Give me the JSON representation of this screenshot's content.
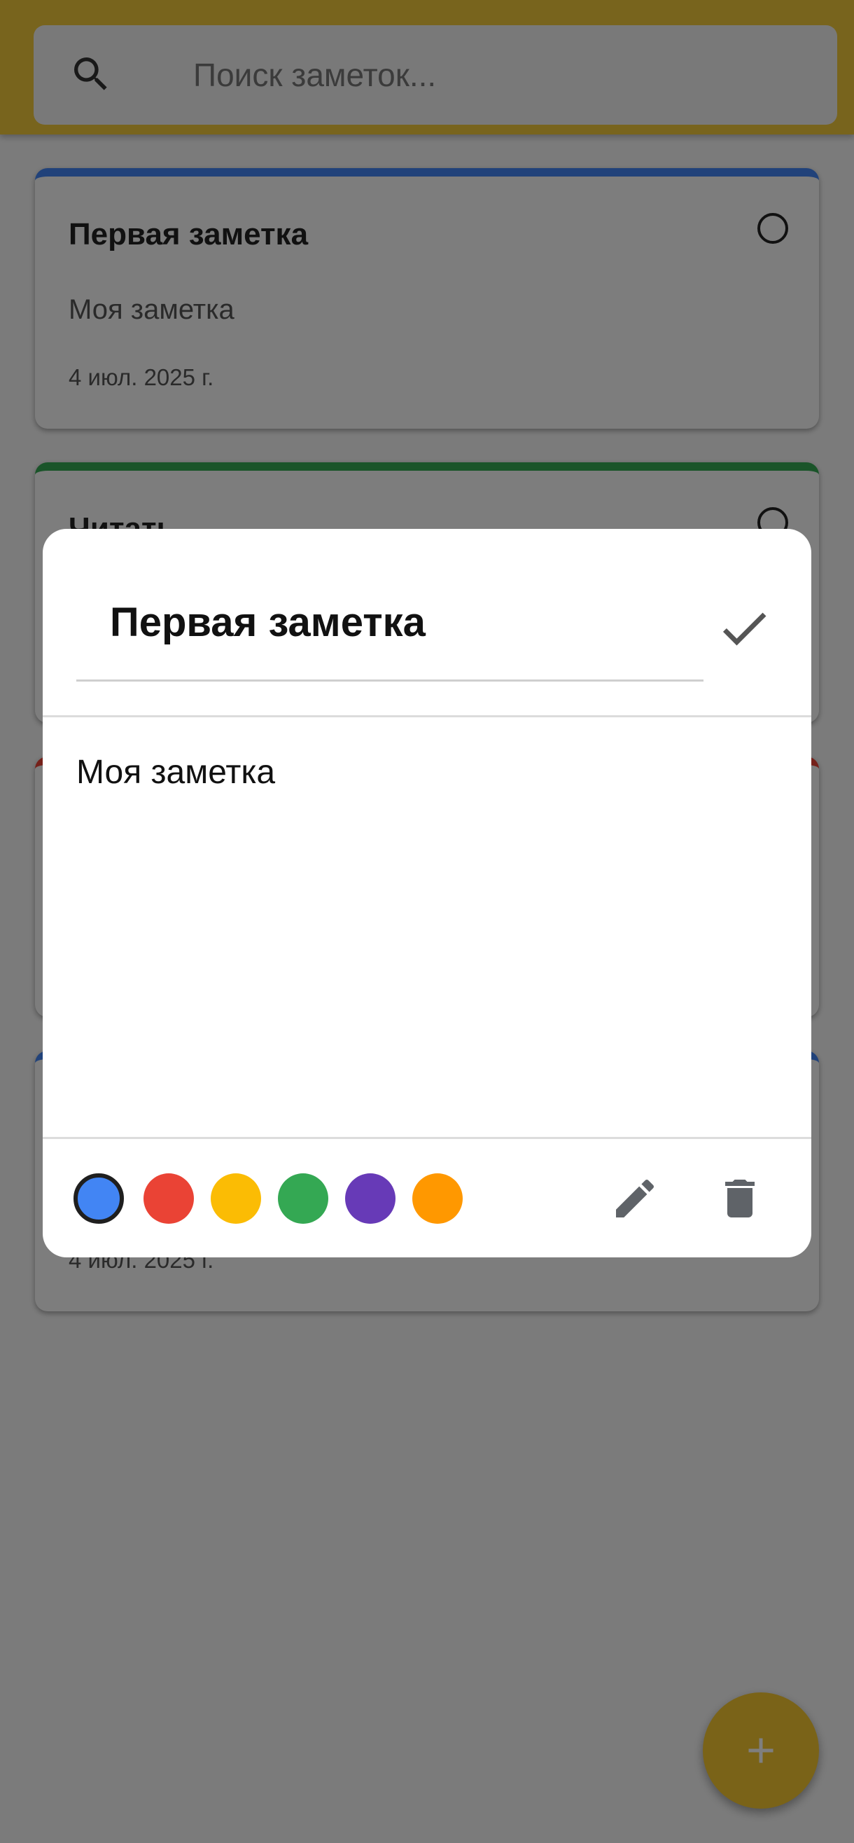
{
  "search": {
    "placeholder": "Поиск заметок...",
    "icon": "search-icon"
  },
  "notes": [
    {
      "title": "Первая заметка",
      "text": "Моя заметка",
      "date": "4 июл. 2025 г.",
      "color": "#4285f4"
    },
    {
      "title": "Читать",
      "color": "#34a853"
    },
    {
      "color": "#ea4335"
    },
    {
      "date": "4 июл. 2025 г.",
      "color": "#4285f4"
    }
  ],
  "dialog": {
    "title": "Первая заметка",
    "body": "Моя заметка",
    "colors": [
      "#4285f4",
      "#ea4335",
      "#fbbc04",
      "#34a853",
      "#673ab7",
      "#ff9800"
    ],
    "selected_color": "#4285f4",
    "icons": [
      "check-icon",
      "edit-icon",
      "delete-icon"
    ]
  },
  "fab": {
    "icon": "plus-icon"
  },
  "theme": {
    "accent": "#f5c631"
  }
}
